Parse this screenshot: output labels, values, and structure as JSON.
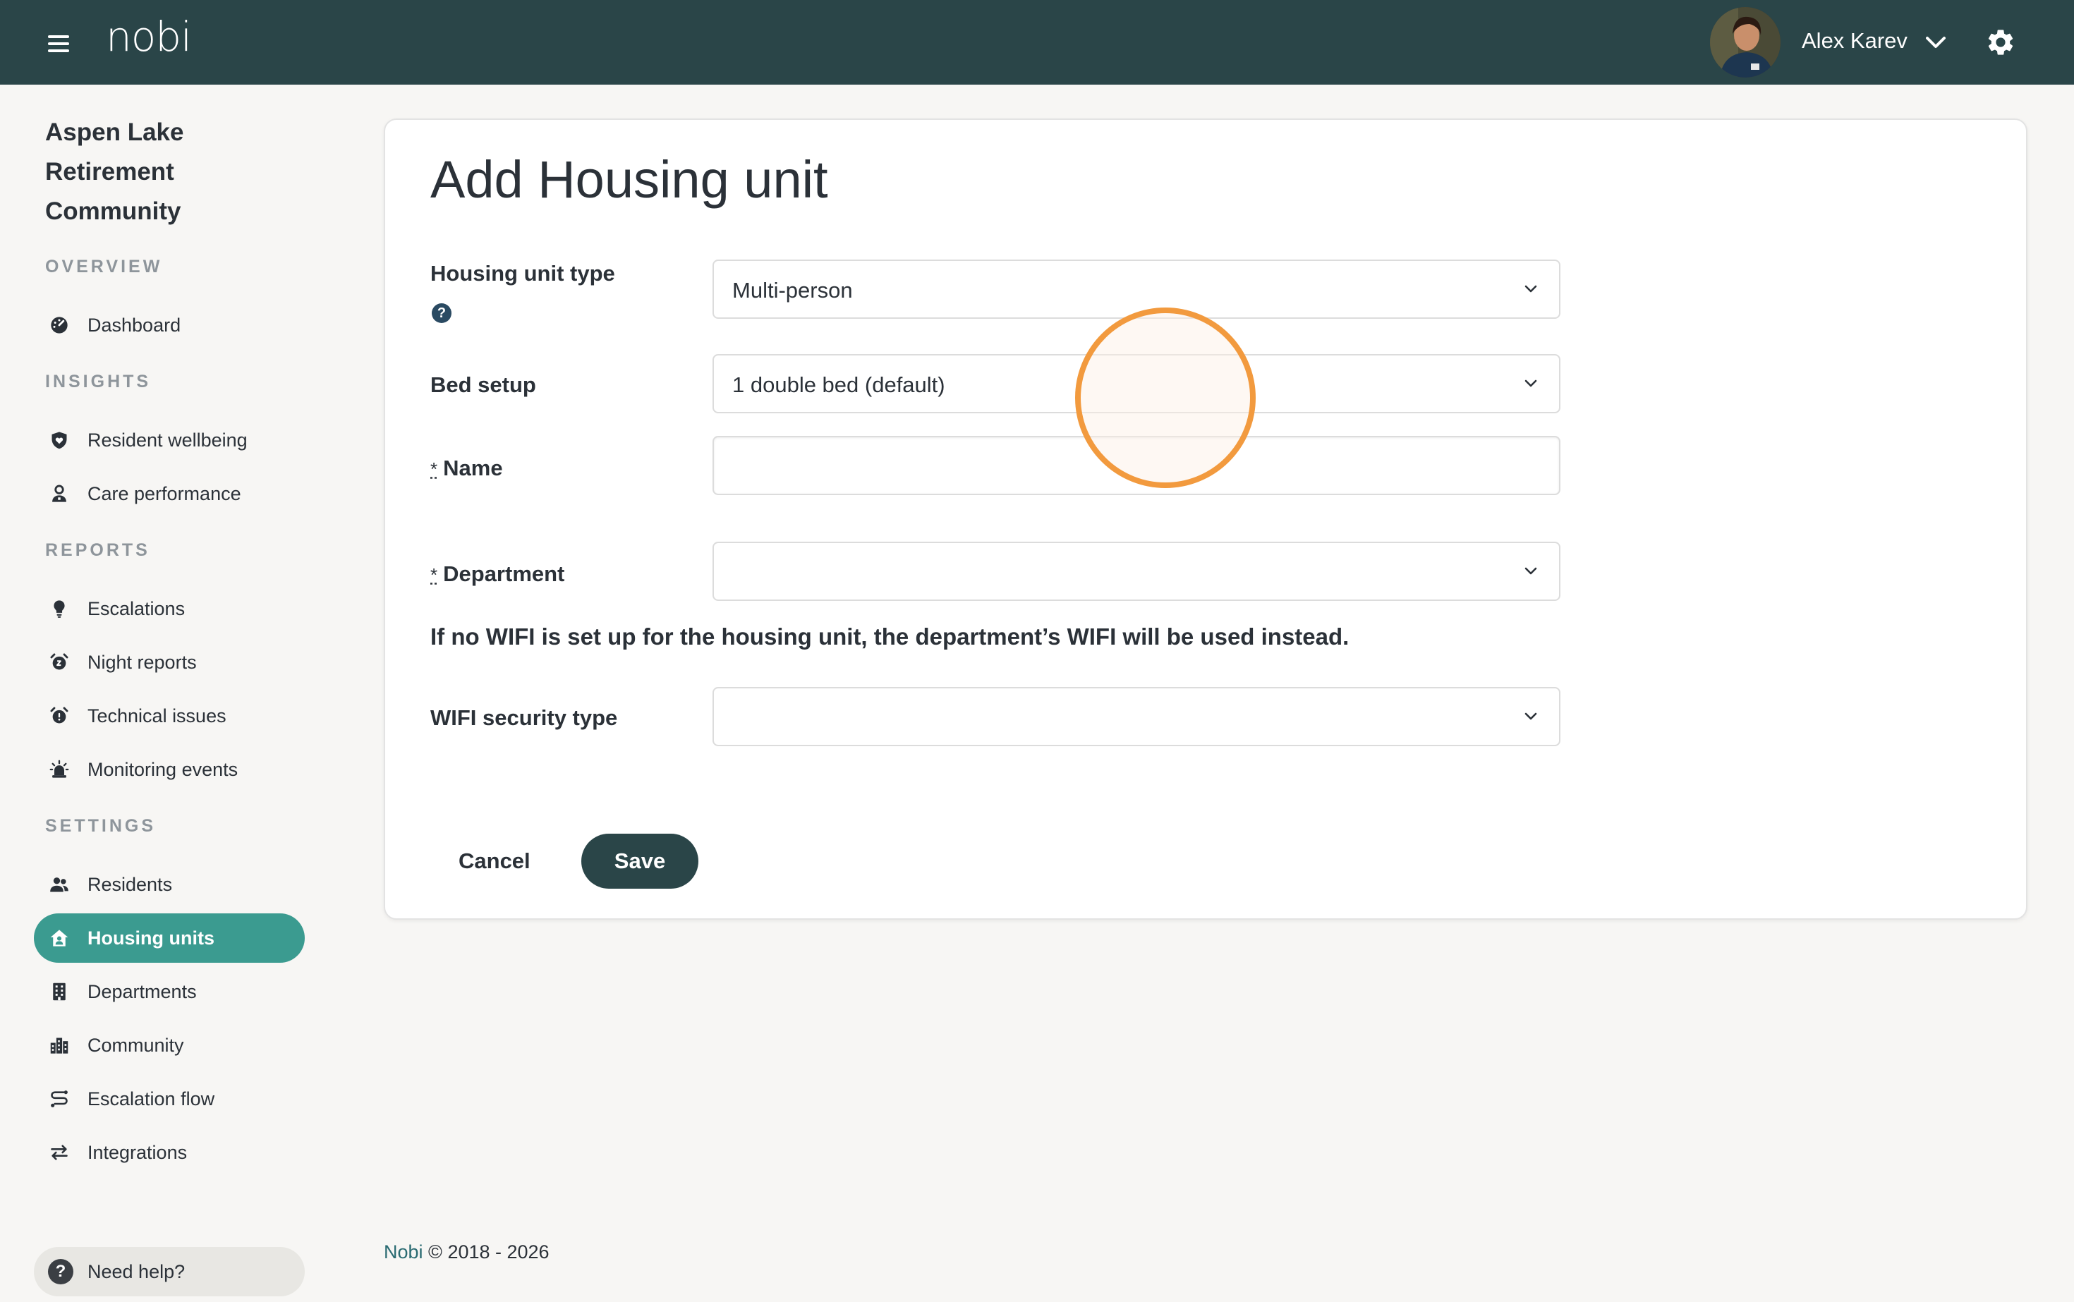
{
  "app": {
    "logo": "nobi",
    "user_name": "Alex Karev"
  },
  "sidebar": {
    "community_name": "Aspen Lake Retirement Community",
    "sections": {
      "overview": "OVERVIEW",
      "insights": "INSIGHTS",
      "reports": "REPORTS",
      "settings": "SETTINGS"
    },
    "items": {
      "dashboard": "Dashboard",
      "resident_wellbeing": "Resident wellbeing",
      "care_performance": "Care performance",
      "escalations": "Escalations",
      "night_reports": "Night reports",
      "technical_issues": "Technical issues",
      "monitoring_events": "Monitoring events",
      "residents": "Residents",
      "housing_units": "Housing units",
      "departments": "Departments",
      "community": "Community",
      "escalation_flow": "Escalation flow",
      "integrations": "Integrations"
    },
    "active_item": "Housing units",
    "help_label": "Need help?"
  },
  "form": {
    "title": "Add Housing unit",
    "housing_unit_type": {
      "label": "Housing unit type",
      "value": "Multi-person"
    },
    "bed_setup": {
      "label": "Bed setup",
      "value": "1 double bed (default)"
    },
    "name": {
      "required_marker": "*",
      "label": "Name",
      "value": ""
    },
    "department": {
      "required_marker": "*",
      "label": "Department",
      "value": ""
    },
    "wifi_note": "If no WIFI is set up for the housing unit, the department’s WIFI will be used instead.",
    "wifi_security_type": {
      "label": "WIFI security type",
      "value": ""
    },
    "cancel_label": "Cancel",
    "save_label": "Save"
  },
  "footer": {
    "brand": "Nobi",
    "copyright": "© 2018 - 2026"
  },
  "colors": {
    "topbar": "#2a4548",
    "accent": "#3b9b90",
    "primary_button": "#2a4548",
    "highlight_ring": "#f29a3e",
    "background": "#f7f6f4"
  }
}
